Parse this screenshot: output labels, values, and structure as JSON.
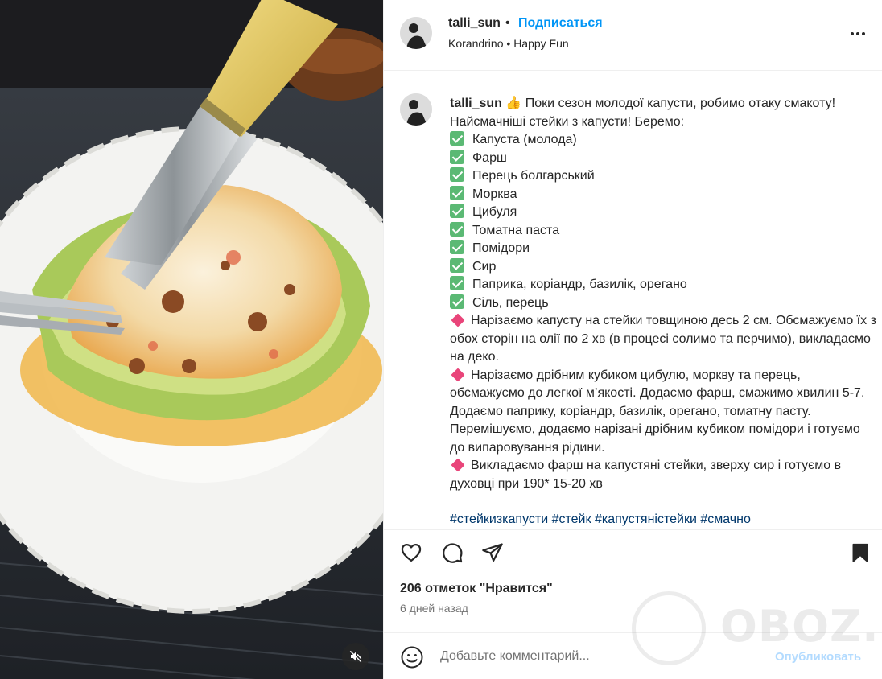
{
  "post": {
    "username": "talli_sun",
    "header_sep": "•",
    "follow_label": "Подписаться",
    "audio": {
      "artist": "Korandrino",
      "sep": "•",
      "track": "Happy Fun"
    }
  },
  "caption": {
    "username": "talli_sun",
    "emoji": "👍",
    "intro": " Поки сезон молодої капусти, робимо отаку смакоту! Найсмачніші стейки з капусти! Беремо:",
    "ingredients": [
      "Капуста (молода)",
      "Фарш",
      "Перець болгарський",
      "Морква",
      "Цибуля",
      "Томатна паста",
      "Помідори",
      "Сир",
      "Паприка, коріандр, базилік, орегано",
      "Сіль, перець"
    ],
    "steps": [
      "Нарізаємо капусту на стейки товщиною десь 2 см. Обсмажуємо їх з обох сторін на олії по 2 хв (в процесі солимо та перчимо), викладаємо на деко.",
      "Нарізаємо дрібним кубиком цибулю, моркву та перець, обсмажуємо до легкої м’якості. Додаємо фарш, смажимо хвилин 5-7. Додаємо паприку, коріандр, базилік, орегано, томатну пасту. Перемішуємо, додаємо нарізані дрібним кубиком помідори і готуємо до випаровування рідини.",
      "Викладаємо фарш на капустяні стейки, зверху сир і готуємо в духовці при 190* 15-20 хв"
    ],
    "hashtags": [
      "#стейкизкапусти",
      "#стейк",
      "#капустяністейки",
      "#смачно"
    ]
  },
  "stats": {
    "likes": "206 отметок \"Нравится\"",
    "time": "6 дней назад"
  },
  "comment": {
    "placeholder": "Добавьте комментарий...",
    "publish_label": "Опубликовать"
  },
  "watermark": "OBOZ.UA",
  "icons": {
    "like": "heart-icon",
    "comment": "comment-icon",
    "share": "share-icon",
    "save": "bookmark-icon",
    "emoji": "emoji-icon",
    "more": "more-icon",
    "mute": "sound-off-icon"
  },
  "colors": {
    "accent": "#0095f6",
    "link": "#00376b",
    "checkbox": "#5bb974",
    "diamond": "#e9457a",
    "publish_disabled": "#b3dbff"
  }
}
